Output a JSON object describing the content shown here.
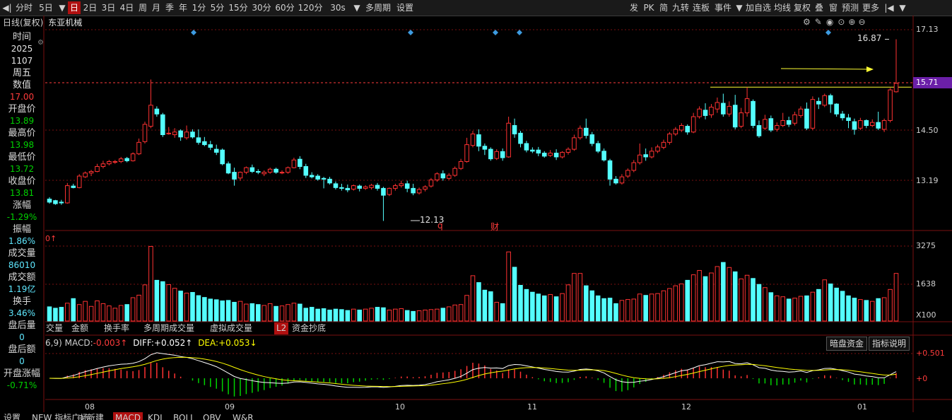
{
  "toolbar": {
    "left_items": [
      {
        "label": "◀|",
        "sel": false
      },
      {
        "label": "分时",
        "sel": false
      },
      {
        "label": "5日",
        "sel": false
      },
      {
        "label": "▼",
        "sel": false
      },
      {
        "label": "日",
        "sel": true
      },
      {
        "label": "2日",
        "sel": false
      },
      {
        "label": "3日",
        "sel": false
      },
      {
        "label": "4日",
        "sel": false
      },
      {
        "label": "周",
        "sel": false
      },
      {
        "label": "月",
        "sel": false
      },
      {
        "label": "季",
        "sel": false
      },
      {
        "label": "年",
        "sel": false
      },
      {
        "label": "1分",
        "sel": false
      },
      {
        "label": "5分",
        "sel": false
      },
      {
        "label": "15分",
        "sel": false
      },
      {
        "label": "30分",
        "sel": false
      },
      {
        "label": "60分",
        "sel": false
      },
      {
        "label": "120分",
        "sel": false
      },
      {
        "label": "30s",
        "sel": false
      },
      {
        "label": "▼",
        "sel": false
      },
      {
        "label": "多周期",
        "sel": false
      },
      {
        "label": "设置",
        "sel": false
      }
    ],
    "right_items": [
      "发",
      "PK",
      "简",
      "九转",
      "连板",
      "事件",
      "▼",
      "加自选",
      "均线",
      "复权",
      "叠",
      "窗",
      "预测",
      "更多",
      "|◀",
      "▼"
    ]
  },
  "chart_header": {
    "mode": "日线(复权)",
    "stock_name": "东亚机械"
  },
  "price_axis": {
    "labels": [
      "17.13",
      "15.71",
      "14.50",
      "13.19"
    ],
    "current": "15.71"
  },
  "annotations": {
    "high_label": "16.87",
    "low_label": "12.13",
    "marker_q": "q",
    "marker_cai": "财"
  },
  "info_panel": [
    {
      "label": "时间",
      "value": "2025",
      "color": "white"
    },
    {
      "label": "",
      "value": "1107",
      "color": "white"
    },
    {
      "label": "",
      "value": "周五",
      "color": "white",
      "big": true
    },
    {
      "label": "数值",
      "value": "17.00",
      "color": "red"
    },
    {
      "label": "开盘价",
      "value": "13.89",
      "color": "green"
    },
    {
      "label": "最高价",
      "value": "13.98",
      "color": "green"
    },
    {
      "label": "最低价",
      "value": "13.72",
      "color": "green"
    },
    {
      "label": "收盘价",
      "value": "13.81",
      "color": "green"
    },
    {
      "label": "涨幅",
      "value": "-1.29%",
      "color": "green"
    },
    {
      "label": "振幅",
      "value": "1.86%",
      "color": "cyan"
    },
    {
      "label": "成交量",
      "value": "86010",
      "color": "cyan"
    },
    {
      "label": "成交额",
      "value": "1.19亿",
      "color": "cyan"
    },
    {
      "label": "换手",
      "value": "3.46%",
      "color": "cyan"
    },
    {
      "label": "盘后量",
      "value": "0",
      "color": "cyan"
    },
    {
      "label": "盘后额",
      "value": "0",
      "color": "cyan"
    },
    {
      "label": "开盘涨幅",
      "value": "-0.71%",
      "color": "green"
    }
  ],
  "volume_axis": {
    "labels": [
      "3275",
      "1638",
      "X100"
    ]
  },
  "volume_tabs": [
    "交量",
    "金额",
    "换手率",
    "多周期成交量",
    "虚拟成交量",
    "L2",
    "资金抄底"
  ],
  "volume_header": "0↑",
  "macd": {
    "params": "6,9)",
    "macd_label": "MACD:",
    "macd_value": "-0.003↑",
    "diff_label": "DIFF:",
    "diff_value": "+0.052↑",
    "dea_label": "DEA:",
    "dea_value": "+0.053↓",
    "axis": [
      "+0.501",
      "+0"
    ],
    "buttons": [
      "暗盘资金",
      "指标说明"
    ]
  },
  "x_axis": [
    "08",
    "09",
    "10",
    "11",
    "12",
    "01"
  ],
  "bottom_tabs": [
    {
      "label": "设置",
      "sel": false
    },
    {
      "label": "NEW 指标广场",
      "sel": false
    },
    {
      "label": "⊖ 新建",
      "sel": false
    },
    {
      "label": "MACD",
      "sel": true
    },
    {
      "label": "KDJ",
      "sel": false
    },
    {
      "label": "BOLL",
      "sel": false
    },
    {
      "label": "OBV",
      "sel": false
    },
    {
      "label": "W&R",
      "sel": false
    }
  ],
  "colors": {
    "up": "#ff3232",
    "down": "#54ffff",
    "grid": "#7a1010",
    "diff": "#ffffff",
    "dea": "#ffff00"
  },
  "candles": [
    [
      12.7,
      12.75,
      12.62,
      12.58
    ],
    [
      12.66,
      12.68,
      12.58,
      12.55
    ],
    [
      12.62,
      12.68,
      12.6,
      12.55
    ],
    [
      12.6,
      13.12,
      13.05,
      12.58
    ],
    [
      13.04,
      13.1,
      13.0,
      12.98
    ],
    [
      13.0,
      13.35,
      13.3,
      12.98
    ],
    [
      13.28,
      13.42,
      13.38,
      13.25
    ],
    [
      13.38,
      13.46,
      13.42,
      13.3
    ],
    [
      13.42,
      13.62,
      13.55,
      13.4
    ],
    [
      13.55,
      13.7,
      13.62,
      13.5
    ],
    [
      13.62,
      13.72,
      13.68,
      13.58
    ],
    [
      13.66,
      13.72,
      13.68,
      13.62
    ],
    [
      13.68,
      13.8,
      13.75,
      13.64
    ],
    [
      13.76,
      13.8,
      13.7,
      13.66
    ],
    [
      13.7,
      13.92,
      13.88,
      13.68
    ],
    [
      13.88,
      14.28,
      14.18,
      13.85
    ],
    [
      14.2,
      14.72,
      14.65,
      14.15
    ],
    [
      14.6,
      15.82,
      15.15,
      14.55
    ],
    [
      15.05,
      15.12,
      14.92,
      14.85
    ],
    [
      14.9,
      14.95,
      14.38,
      14.32
    ],
    [
      14.42,
      14.58,
      14.42,
      14.38
    ],
    [
      14.38,
      14.55,
      14.45,
      14.3
    ],
    [
      14.48,
      14.52,
      14.32,
      14.22
    ],
    [
      14.3,
      14.62,
      14.45,
      14.25
    ],
    [
      14.45,
      14.52,
      14.32,
      14.28
    ],
    [
      14.3,
      14.52,
      14.18,
      14.12
    ],
    [
      14.2,
      14.32,
      14.12,
      14.08
    ],
    [
      14.12,
      14.22,
      14.05,
      13.98
    ],
    [
      14.0,
      14.12,
      13.92,
      13.85
    ],
    [
      13.98,
      14.02,
      13.62,
      13.58
    ],
    [
      13.62,
      13.68,
      13.38,
      13.35
    ],
    [
      13.4,
      13.52,
      13.22,
      13.05
    ],
    [
      13.25,
      13.42,
      13.4,
      13.18
    ],
    [
      13.4,
      13.55,
      13.52,
      13.35
    ],
    [
      13.52,
      13.6,
      13.42,
      13.38
    ],
    [
      13.42,
      13.48,
      13.4,
      13.35
    ],
    [
      13.36,
      13.45,
      13.4,
      13.3
    ],
    [
      13.4,
      13.52,
      13.48,
      13.36
    ],
    [
      13.48,
      13.52,
      13.4,
      13.36
    ],
    [
      13.38,
      13.45,
      13.4,
      13.35
    ],
    [
      13.4,
      13.55,
      13.52,
      13.36
    ],
    [
      13.52,
      13.78,
      13.72,
      13.5
    ],
    [
      13.74,
      13.82,
      13.55,
      13.48
    ],
    [
      13.55,
      13.62,
      13.32,
      13.25
    ],
    [
      13.32,
      13.4,
      13.28,
      13.24
    ],
    [
      13.3,
      13.35,
      13.22,
      13.18
    ],
    [
      13.24,
      13.28,
      13.22,
      12.98
    ],
    [
      13.22,
      13.28,
      13.12,
      13.08
    ],
    [
      13.1,
      13.16,
      13.0,
      12.95
    ],
    [
      13.0,
      13.1,
      12.98,
      12.92
    ],
    [
      12.98,
      13.08,
      12.94,
      12.88
    ],
    [
      12.96,
      13.08,
      13.05,
      12.92
    ],
    [
      13.04,
      13.08,
      12.98,
      12.9
    ],
    [
      12.98,
      13.06,
      13.02,
      12.94
    ],
    [
      13.0,
      13.1,
      13.06,
      12.95
    ],
    [
      13.06,
      13.12,
      12.98,
      12.92
    ],
    [
      12.98,
      13.02,
      12.8,
      12.13
    ],
    [
      12.82,
      13.0,
      12.98,
      12.78
    ],
    [
      12.98,
      13.1,
      13.05,
      12.92
    ],
    [
      13.05,
      13.18,
      13.1,
      13.0
    ],
    [
      13.1,
      13.18,
      12.98,
      12.88
    ],
    [
      12.98,
      13.1,
      12.86,
      12.8
    ],
    [
      12.86,
      13.0,
      12.95,
      12.82
    ],
    [
      12.96,
      13.06,
      13.02,
      12.9
    ],
    [
      13.04,
      13.25,
      13.2,
      13.0
    ],
    [
      13.2,
      13.4,
      13.36,
      13.15
    ],
    [
      13.36,
      13.45,
      13.25,
      13.18
    ],
    [
      13.24,
      13.38,
      13.32,
      13.2
    ],
    [
      13.32,
      13.55,
      13.5,
      13.28
    ],
    [
      13.5,
      13.75,
      13.68,
      13.46
    ],
    [
      13.68,
      14.3,
      14.12,
      13.65
    ],
    [
      14.1,
      14.48,
      14.4,
      14.05
    ],
    [
      14.38,
      14.52,
      14.08,
      13.95
    ],
    [
      14.08,
      14.15,
      14.0,
      13.85
    ],
    [
      14.0,
      14.05,
      13.75,
      13.7
    ],
    [
      13.76,
      14.0,
      13.94,
      13.72
    ],
    [
      13.94,
      14.02,
      13.78,
      13.7
    ],
    [
      13.8,
      14.85,
      14.68,
      13.78
    ],
    [
      14.62,
      14.8,
      14.4,
      14.3
    ],
    [
      14.42,
      14.48,
      14.15,
      14.05
    ],
    [
      14.15,
      14.22,
      13.98,
      13.92
    ],
    [
      13.98,
      14.05,
      13.95,
      13.9
    ],
    [
      13.98,
      14.06,
      13.9,
      13.82
    ],
    [
      13.9,
      13.95,
      13.82,
      13.78
    ],
    [
      13.84,
      13.98,
      13.9,
      13.8
    ],
    [
      13.9,
      14.0,
      13.8,
      13.72
    ],
    [
      13.8,
      13.95,
      13.92,
      13.76
    ],
    [
      13.92,
      14.05,
      14.0,
      13.86
    ],
    [
      14.0,
      14.38,
      14.3,
      13.96
    ],
    [
      14.3,
      14.62,
      14.55,
      14.25
    ],
    [
      14.55,
      14.8,
      14.36,
      14.28
    ],
    [
      14.38,
      14.45,
      14.15,
      14.08
    ],
    [
      14.15,
      14.22,
      13.95,
      13.9
    ],
    [
      13.95,
      14.02,
      13.72,
      13.68
    ],
    [
      13.7,
      13.75,
      13.22,
      13.05
    ],
    [
      13.22,
      13.3,
      13.12,
      13.08
    ],
    [
      13.12,
      13.35,
      13.28,
      13.08
    ],
    [
      13.3,
      13.5,
      13.45,
      13.25
    ],
    [
      13.45,
      13.72,
      13.65,
      13.4
    ],
    [
      13.65,
      14.15,
      13.85,
      13.6
    ],
    [
      13.86,
      14.02,
      13.8,
      13.7
    ],
    [
      13.8,
      14.05,
      13.95,
      13.76
    ],
    [
      13.95,
      14.12,
      14.06,
      13.9
    ],
    [
      14.05,
      14.25,
      14.18,
      14.0
    ],
    [
      14.18,
      14.45,
      14.4,
      14.12
    ],
    [
      14.4,
      14.58,
      14.52,
      14.35
    ],
    [
      14.5,
      14.68,
      14.62,
      14.45
    ],
    [
      14.6,
      14.65,
      14.45,
      14.38
    ],
    [
      14.45,
      14.95,
      14.85,
      14.42
    ],
    [
      14.85,
      15.12,
      15.05,
      14.8
    ],
    [
      15.02,
      15.2,
      14.88,
      14.78
    ],
    [
      14.9,
      15.18,
      15.1,
      14.82
    ],
    [
      15.05,
      15.35,
      15.22,
      14.95
    ],
    [
      15.2,
      15.45,
      14.92,
      14.85
    ],
    [
      14.92,
      15.25,
      15.12,
      14.85
    ],
    [
      15.15,
      15.42,
      14.58,
      14.52
    ],
    [
      14.6,
      15.08,
      14.95,
      14.55
    ],
    [
      14.95,
      15.62,
      15.32,
      14.85
    ],
    [
      15.25,
      15.3,
      14.62,
      14.55
    ],
    [
      14.62,
      14.75,
      14.35,
      14.3
    ],
    [
      14.55,
      14.9,
      14.78,
      14.5
    ],
    [
      14.8,
      14.88,
      14.5,
      14.45
    ],
    [
      14.52,
      14.7,
      14.62,
      14.46
    ],
    [
      14.62,
      14.95,
      14.75,
      14.58
    ],
    [
      14.75,
      14.85,
      14.65,
      14.58
    ],
    [
      14.68,
      14.98,
      14.9,
      14.62
    ],
    [
      14.88,
      15.12,
      15.05,
      14.82
    ],
    [
      15.05,
      15.22,
      14.55,
      14.5
    ],
    [
      14.55,
      15.38,
      15.3,
      14.5
    ],
    [
      15.25,
      15.35,
      15.18,
      15.05
    ],
    [
      15.15,
      15.45,
      15.4,
      15.1
    ],
    [
      15.4,
      15.45,
      15.18,
      14.95
    ],
    [
      15.18,
      15.2,
      14.92,
      14.85
    ],
    [
      14.92,
      15.0,
      14.82,
      14.75
    ],
    [
      14.82,
      14.92,
      14.75,
      14.55
    ],
    [
      14.72,
      14.8,
      14.52,
      14.38
    ],
    [
      14.55,
      14.82,
      14.75,
      14.5
    ],
    [
      14.75,
      14.78,
      14.62,
      14.55
    ],
    [
      14.62,
      14.78,
      14.7,
      14.58
    ],
    [
      14.7,
      14.98,
      14.55,
      14.5
    ],
    [
      14.52,
      14.8,
      14.75,
      14.45
    ],
    [
      14.75,
      15.6,
      15.55,
      14.7
    ],
    [
      15.5,
      16.87,
      15.72,
      15.48
    ]
  ],
  "volumes": [
    620,
    560,
    600,
    780,
    980,
    720,
    860,
    640,
    880,
    760,
    660,
    560,
    680,
    720,
    1020,
    1130,
    1580,
    3260,
    1780,
    1720,
    1590,
    1430,
    1310,
    1220,
    1250,
    1110,
    1030,
    960,
    930,
    880,
    900,
    820,
    860,
    740,
    760,
    720,
    680,
    760,
    640,
    660,
    720,
    780,
    740,
    560,
    600,
    520,
    540,
    480,
    520,
    500,
    460,
    520,
    480,
    520,
    560,
    600,
    580,
    480,
    520,
    540,
    460,
    420,
    450,
    480,
    500,
    520,
    560,
    620,
    700,
    720,
    1120,
    1980,
    1680,
    1350,
    1280,
    820,
    760,
    3020,
    2350,
    1560,
    1380,
    1260,
    1180,
    1100,
    1160,
    1060,
    1200,
    1580,
    2080,
    2080,
    1540,
    1320,
    1100,
    980,
    1000,
    760,
    900,
    940,
    960,
    1180,
    1120,
    1180,
    1200,
    1320,
    1420,
    1540,
    1620,
    1780,
    2020,
    2210,
    1940,
    2100,
    2380,
    2560,
    2340,
    2150,
    1840,
    2000,
    1860,
    1600,
    1460,
    1240,
    1100,
    1060,
    960,
    1000,
    1080,
    1100,
    1260,
    1380,
    1800,
    1620,
    1440,
    1300,
    1100,
    1000,
    940,
    900,
    860,
    980,
    1020,
    1380,
    2080
  ]
}
